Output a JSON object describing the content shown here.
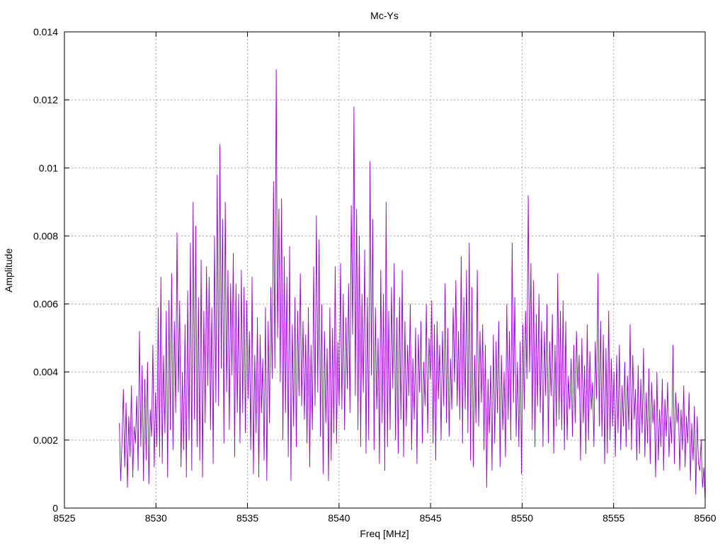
{
  "chart_data": {
    "type": "line",
    "title": "Mc-Ys",
    "xlabel": "Freq [MHz]",
    "ylabel": "Amplitude",
    "xlim": [
      8525,
      8560
    ],
    "ylim": [
      0,
      0.014
    ],
    "x_ticks": [
      "8525",
      "8530",
      "8535",
      "8540",
      "8545",
      "8550",
      "8555",
      "8560"
    ],
    "y_ticks": [
      "0",
      "0.002",
      "0.004",
      "0.006",
      "0.008",
      "0.01",
      "0.012",
      "0.014"
    ],
    "grid": true,
    "legend": "none",
    "line_color": "#9400d3",
    "x_start": 8528.0,
    "x_end": 8560.0,
    "series": [
      {
        "values": [
          0.0025,
          0.0008,
          0.002,
          0.0035,
          0.0012,
          0.0031,
          0.0006,
          0.0027,
          0.0015,
          0.0036,
          0.0009,
          0.0024,
          0.0019,
          0.0033,
          0.0011,
          0.0052,
          0.0018,
          0.0042,
          0.0008,
          0.0038,
          0.0014,
          0.0043,
          0.0007,
          0.0029,
          0.0021,
          0.0048,
          0.0012,
          0.0034,
          0.0018,
          0.0059,
          0.0015,
          0.0068,
          0.0013,
          0.0045,
          0.0022,
          0.0058,
          0.0009,
          0.0061,
          0.0023,
          0.0069,
          0.0017,
          0.0055,
          0.0028,
          0.0081,
          0.0034,
          0.0061,
          0.0012,
          0.004,
          0.0017,
          0.0054,
          0.0009,
          0.0064,
          0.002,
          0.0078,
          0.0011,
          0.009,
          0.0026,
          0.0083,
          0.0018,
          0.0062,
          0.0014,
          0.0073,
          0.0009,
          0.0058,
          0.0025,
          0.0071,
          0.0036,
          0.0068,
          0.0023,
          0.0059,
          0.0013,
          0.008,
          0.0031,
          0.0098,
          0.003,
          0.0107,
          0.0041,
          0.0085,
          0.0019,
          0.009,
          0.0034,
          0.007,
          0.0023,
          0.0066,
          0.0039,
          0.0075,
          0.0015,
          0.0066,
          0.0028,
          0.0063,
          0.0019,
          0.007,
          0.0028,
          0.0065,
          0.0022,
          0.0061,
          0.0032,
          0.0052,
          0.0017,
          0.0068,
          0.001,
          0.0045,
          0.0022,
          0.0056,
          0.0009,
          0.0051,
          0.0028,
          0.0044,
          0.0014,
          0.0059,
          0.0008,
          0.0055,
          0.0025,
          0.0065,
          0.0038,
          0.0096,
          0.0041,
          0.0129,
          0.005,
          0.0088,
          0.0037,
          0.0091,
          0.002,
          0.0074,
          0.0028,
          0.0068,
          0.0015,
          0.0077,
          0.0008,
          0.0054,
          0.0024,
          0.0062,
          0.0018,
          0.0058,
          0.0033,
          0.0069,
          0.003,
          0.0055,
          0.0026,
          0.0051,
          0.0019,
          0.0059,
          0.0012,
          0.0048,
          0.0023,
          0.0071,
          0.003,
          0.0086,
          0.0034,
          0.0079,
          0.0021,
          0.006,
          0.001,
          0.0052,
          0.0025,
          0.0047,
          0.0008,
          0.0059,
          0.0014,
          0.0053,
          0.0022,
          0.0071,
          0.0019,
          0.0049,
          0.003,
          0.0072,
          0.0029,
          0.0063,
          0.0023,
          0.0056,
          0.0035,
          0.0066,
          0.0028,
          0.0089,
          0.0051,
          0.0118,
          0.0033,
          0.0088,
          0.0023,
          0.008,
          0.0018,
          0.0063,
          0.0034,
          0.0076,
          0.0016,
          0.0062,
          0.002,
          0.0102,
          0.0039,
          0.0085,
          0.0017,
          0.0059,
          0.0029,
          0.005,
          0.0013,
          0.007,
          0.0025,
          0.0063,
          0.0011,
          0.009,
          0.0018,
          0.0058,
          0.0023,
          0.0065,
          0.0035,
          0.0072,
          0.002,
          0.0056,
          0.0016,
          0.0062,
          0.0026,
          0.007,
          0.0015,
          0.0055,
          0.0024,
          0.0048,
          0.0033,
          0.006,
          0.0017,
          0.0044,
          0.0026,
          0.0053,
          0.0013,
          0.0051,
          0.0034,
          0.0055,
          0.0019,
          0.0043,
          0.003,
          0.006,
          0.0022,
          0.005,
          0.0038,
          0.0061,
          0.0019,
          0.0054,
          0.0014,
          0.0055,
          0.0032,
          0.0048,
          0.002,
          0.0052,
          0.003,
          0.0066,
          0.0025,
          0.0053,
          0.0021,
          0.0044,
          0.0029,
          0.0059,
          0.0037,
          0.0067,
          0.003,
          0.0052,
          0.0026,
          0.0074,
          0.0019,
          0.0062,
          0.0029,
          0.007,
          0.0022,
          0.0078,
          0.0014,
          0.0065,
          0.0012,
          0.0045,
          0.0025,
          0.007,
          0.0024,
          0.0052,
          0.0031,
          0.0054,
          0.0017,
          0.0048,
          0.0006,
          0.0038,
          0.0022,
          0.0042,
          0.0011,
          0.0051,
          0.0019,
          0.0049,
          0.0028,
          0.0055,
          0.0012,
          0.0045,
          0.0023,
          0.004,
          0.0015,
          0.006,
          0.0026,
          0.0052,
          0.002,
          0.0078,
          0.0031,
          0.0062,
          0.0021,
          0.0043,
          0.0018,
          0.0049,
          0.001,
          0.0054,
          0.0029,
          0.0058,
          0.0038,
          0.0092,
          0.004,
          0.0072,
          0.0023,
          0.0067,
          0.0018,
          0.0057,
          0.003,
          0.0063,
          0.0028,
          0.0055,
          0.0018,
          0.0052,
          0.0033,
          0.006,
          0.0019,
          0.0049,
          0.0033,
          0.0057,
          0.0016,
          0.0048,
          0.0024,
          0.0069,
          0.0026,
          0.0058,
          0.0023,
          0.0061,
          0.0017,
          0.0055,
          0.002,
          0.0039,
          0.0029,
          0.0044,
          0.0021,
          0.0048,
          0.0025,
          0.0052,
          0.0035,
          0.0045,
          0.0014,
          0.005,
          0.0025,
          0.0042,
          0.0016,
          0.0054,
          0.002,
          0.0046,
          0.0029,
          0.0037,
          0.0018,
          0.0049,
          0.0032,
          0.0069,
          0.0024,
          0.0055,
          0.0021,
          0.0051,
          0.0013,
          0.0047,
          0.0016,
          0.0058,
          0.002,
          0.0044,
          0.0024,
          0.004,
          0.0015,
          0.0045,
          0.0022,
          0.0048,
          0.0017,
          0.0036,
          0.0024,
          0.0043,
          0.0018,
          0.0039,
          0.0023,
          0.0054,
          0.0017,
          0.0045,
          0.0026,
          0.0035,
          0.0014,
          0.0042,
          0.0016,
          0.0038,
          0.0022,
          0.0047,
          0.0015,
          0.0034,
          0.0019,
          0.0041,
          0.0013,
          0.0037,
          0.0025,
          0.0032,
          0.0009,
          0.004,
          0.0014,
          0.0029,
          0.0018,
          0.0038,
          0.0011,
          0.0032,
          0.0021,
          0.0037,
          0.0015,
          0.0027,
          0.0019,
          0.0048,
          0.0013,
          0.0034,
          0.0025,
          0.0031,
          0.0011,
          0.0029,
          0.0017,
          0.0036,
          0.0012,
          0.0027,
          0.0019,
          0.0034,
          0.0008,
          0.0025,
          0.0014,
          0.003,
          0.0004,
          0.0027,
          0.0013,
          0.0011,
          0.002,
          0.0006,
          0.0012,
          0.0002
        ]
      }
    ]
  }
}
